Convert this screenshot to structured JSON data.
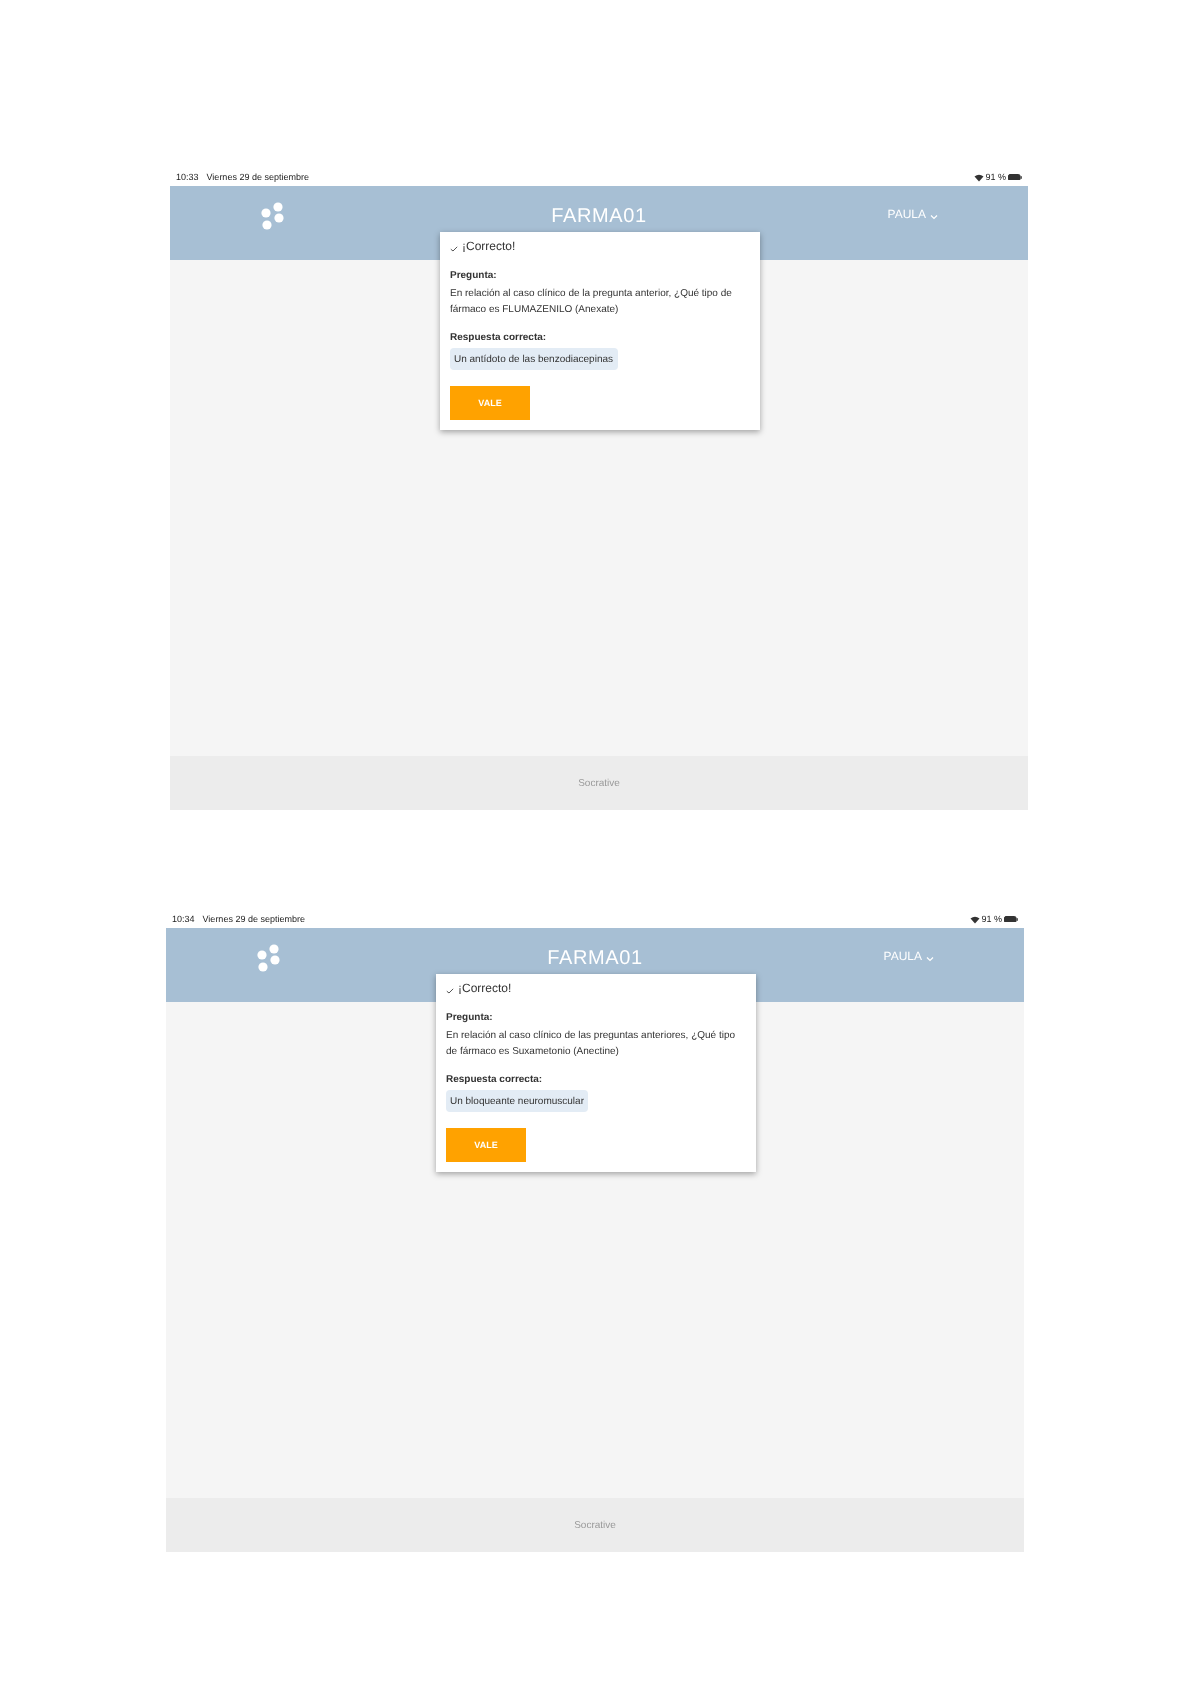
{
  "screenshots": [
    {
      "status_bar": {
        "time": "10:33",
        "date": "Viernes 29 de septiembre",
        "battery": "91 %"
      },
      "header": {
        "title": "FARMA01",
        "user": "PAULA"
      },
      "dialog": {
        "heading": "¡Correcto!",
        "question_label": "Pregunta:",
        "question": "En relación al caso clínico de la pregunta anterior, ¿Qué tipo de fármaco es FLUMAZENILO (Anexate)",
        "answer_label": "Respuesta correcta:",
        "answer": "Un antídoto de las benzodiacepinas",
        "button": "VALE"
      },
      "footer": "Socrative"
    },
    {
      "status_bar": {
        "time": "10:34",
        "date": "Viernes 29 de septiembre",
        "battery": "91 %"
      },
      "header": {
        "title": "FARMA01",
        "user": "PAULA"
      },
      "dialog": {
        "heading": "¡Correcto!",
        "question_label": "Pregunta:",
        "question": "En relación al caso clínico de las preguntas anteriores, ¿Qué tipo de fármaco es Suxametonio (Anectine)",
        "answer_label": "Respuesta correcta:",
        "answer": "Un bloqueante neuromuscular",
        "button": "VALE"
      },
      "footer": "Socrative"
    }
  ]
}
